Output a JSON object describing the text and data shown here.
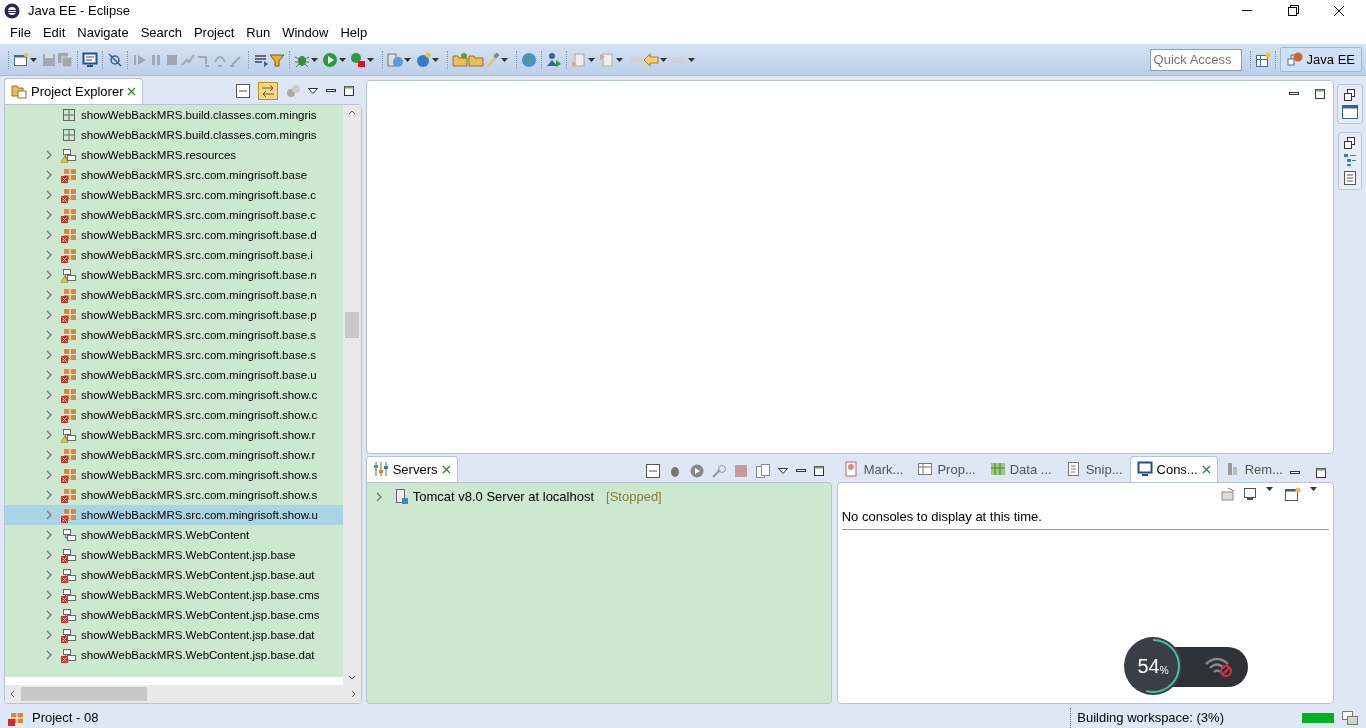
{
  "window": {
    "title": "Java EE - Eclipse"
  },
  "menu": [
    {
      "label": "File"
    },
    {
      "label": "Edit"
    },
    {
      "label": "Navigate"
    },
    {
      "label": "Search"
    },
    {
      "label": "Project"
    },
    {
      "label": "Run"
    },
    {
      "label": "Window"
    },
    {
      "label": "Help"
    }
  ],
  "toolbar": {
    "quick_access": {
      "placeholder": "Quick Access"
    },
    "perspective": {
      "label": "Java EE",
      "selected": true
    }
  },
  "project_explorer": {
    "tab": {
      "label": "Project Explorer",
      "selected": true
    },
    "items": [
      {
        "label": "showWebBackMRS.build.classes.com.mingris",
        "kind": "package",
        "error": false,
        "warning": false,
        "expandable": false,
        "selected": false
      },
      {
        "label": "showWebBackMRS.build.classes.com.mingris",
        "kind": "package",
        "error": false,
        "warning": false,
        "expandable": false,
        "selected": false
      },
      {
        "label": "showWebBackMRS.resources",
        "kind": "folder",
        "error": false,
        "warning": true,
        "expandable": true,
        "selected": false
      },
      {
        "label": "showWebBackMRS.src.com.mingrisoft.base",
        "kind": "package",
        "error": true,
        "warning": false,
        "expandable": true,
        "selected": false
      },
      {
        "label": "showWebBackMRS.src.com.mingrisoft.base.c",
        "kind": "package",
        "error": true,
        "warning": false,
        "expandable": true,
        "selected": false
      },
      {
        "label": "showWebBackMRS.src.com.mingrisoft.base.c",
        "kind": "package",
        "error": true,
        "warning": false,
        "expandable": true,
        "selected": false
      },
      {
        "label": "showWebBackMRS.src.com.mingrisoft.base.d",
        "kind": "package",
        "error": true,
        "warning": false,
        "expandable": true,
        "selected": false
      },
      {
        "label": "showWebBackMRS.src.com.mingrisoft.base.i",
        "kind": "package",
        "error": true,
        "warning": false,
        "expandable": true,
        "selected": false
      },
      {
        "label": "showWebBackMRS.src.com.mingrisoft.base.n",
        "kind": "folder",
        "error": false,
        "warning": true,
        "expandable": true,
        "selected": false
      },
      {
        "label": "showWebBackMRS.src.com.mingrisoft.base.n",
        "kind": "package",
        "error": true,
        "warning": false,
        "expandable": true,
        "selected": false
      },
      {
        "label": "showWebBackMRS.src.com.mingrisoft.base.p",
        "kind": "package",
        "error": true,
        "warning": false,
        "expandable": true,
        "selected": false
      },
      {
        "label": "showWebBackMRS.src.com.mingrisoft.base.s",
        "kind": "package",
        "error": true,
        "warning": false,
        "expandable": true,
        "selected": false
      },
      {
        "label": "showWebBackMRS.src.com.mingrisoft.base.s",
        "kind": "package",
        "error": true,
        "warning": false,
        "expandable": true,
        "selected": false
      },
      {
        "label": "showWebBackMRS.src.com.mingrisoft.base.u",
        "kind": "package",
        "error": true,
        "warning": false,
        "expandable": true,
        "selected": false
      },
      {
        "label": "showWebBackMRS.src.com.mingrisoft.show.c",
        "kind": "package",
        "error": true,
        "warning": false,
        "expandable": true,
        "selected": false
      },
      {
        "label": "showWebBackMRS.src.com.mingrisoft.show.c",
        "kind": "package",
        "error": true,
        "warning": false,
        "expandable": true,
        "selected": false
      },
      {
        "label": "showWebBackMRS.src.com.mingrisoft.show.r",
        "kind": "folder",
        "error": false,
        "warning": true,
        "expandable": true,
        "selected": false
      },
      {
        "label": "showWebBackMRS.src.com.mingrisoft.show.r",
        "kind": "package",
        "error": true,
        "warning": false,
        "expandable": true,
        "selected": false
      },
      {
        "label": "showWebBackMRS.src.com.mingrisoft.show.s",
        "kind": "package",
        "error": true,
        "warning": false,
        "expandable": true,
        "selected": false
      },
      {
        "label": "showWebBackMRS.src.com.mingrisoft.show.s",
        "kind": "package",
        "error": true,
        "warning": false,
        "expandable": true,
        "selected": false
      },
      {
        "label": "showWebBackMRS.src.com.mingrisoft.show.u",
        "kind": "package",
        "error": true,
        "warning": false,
        "expandable": true,
        "selected": true
      },
      {
        "label": "showWebBackMRS.WebContent",
        "kind": "folder",
        "error": false,
        "warning": false,
        "expandable": true,
        "selected": false
      },
      {
        "label": "showWebBackMRS.WebContent.jsp.base",
        "kind": "folder",
        "error": true,
        "warning": false,
        "expandable": true,
        "selected": false
      },
      {
        "label": "showWebBackMRS.WebContent.jsp.base.aut",
        "kind": "folder",
        "error": true,
        "warning": false,
        "expandable": true,
        "selected": false
      },
      {
        "label": "showWebBackMRS.WebContent.jsp.base.cms",
        "kind": "folder",
        "error": true,
        "warning": false,
        "expandable": true,
        "selected": false
      },
      {
        "label": "showWebBackMRS.WebContent.jsp.base.cms",
        "kind": "folder",
        "error": true,
        "warning": false,
        "expandable": true,
        "selected": false
      },
      {
        "label": "showWebBackMRS.WebContent.jsp.base.dat",
        "kind": "folder",
        "error": true,
        "warning": false,
        "expandable": true,
        "selected": false
      },
      {
        "label": "showWebBackMRS.WebContent.jsp.base.dat",
        "kind": "folder",
        "error": true,
        "warning": false,
        "expandable": true,
        "selected": false
      }
    ]
  },
  "servers": {
    "tab": {
      "label": "Servers",
      "selected": true
    },
    "items": [
      {
        "name": "Tomcat v8.0 Server at localhost",
        "state": "[Stopped]",
        "expandable": true
      }
    ]
  },
  "side_tabs": [
    {
      "label": "Mark...",
      "selected": false
    },
    {
      "label": "Prop...",
      "selected": false
    },
    {
      "label": "Data ...",
      "selected": false
    },
    {
      "label": "Snip...",
      "selected": false
    },
    {
      "label": "Cons...",
      "selected": true
    },
    {
      "label": "Rem...",
      "selected": false
    }
  ],
  "console": {
    "message": "No consoles to display at this time."
  },
  "status_bar": {
    "project": "Project - 08",
    "task": "Building workspace: (3%)",
    "progress": {
      "level": 1.0
    }
  },
  "overlay_widget": {
    "value": "54",
    "unit": "%",
    "level": 0.54
  }
}
